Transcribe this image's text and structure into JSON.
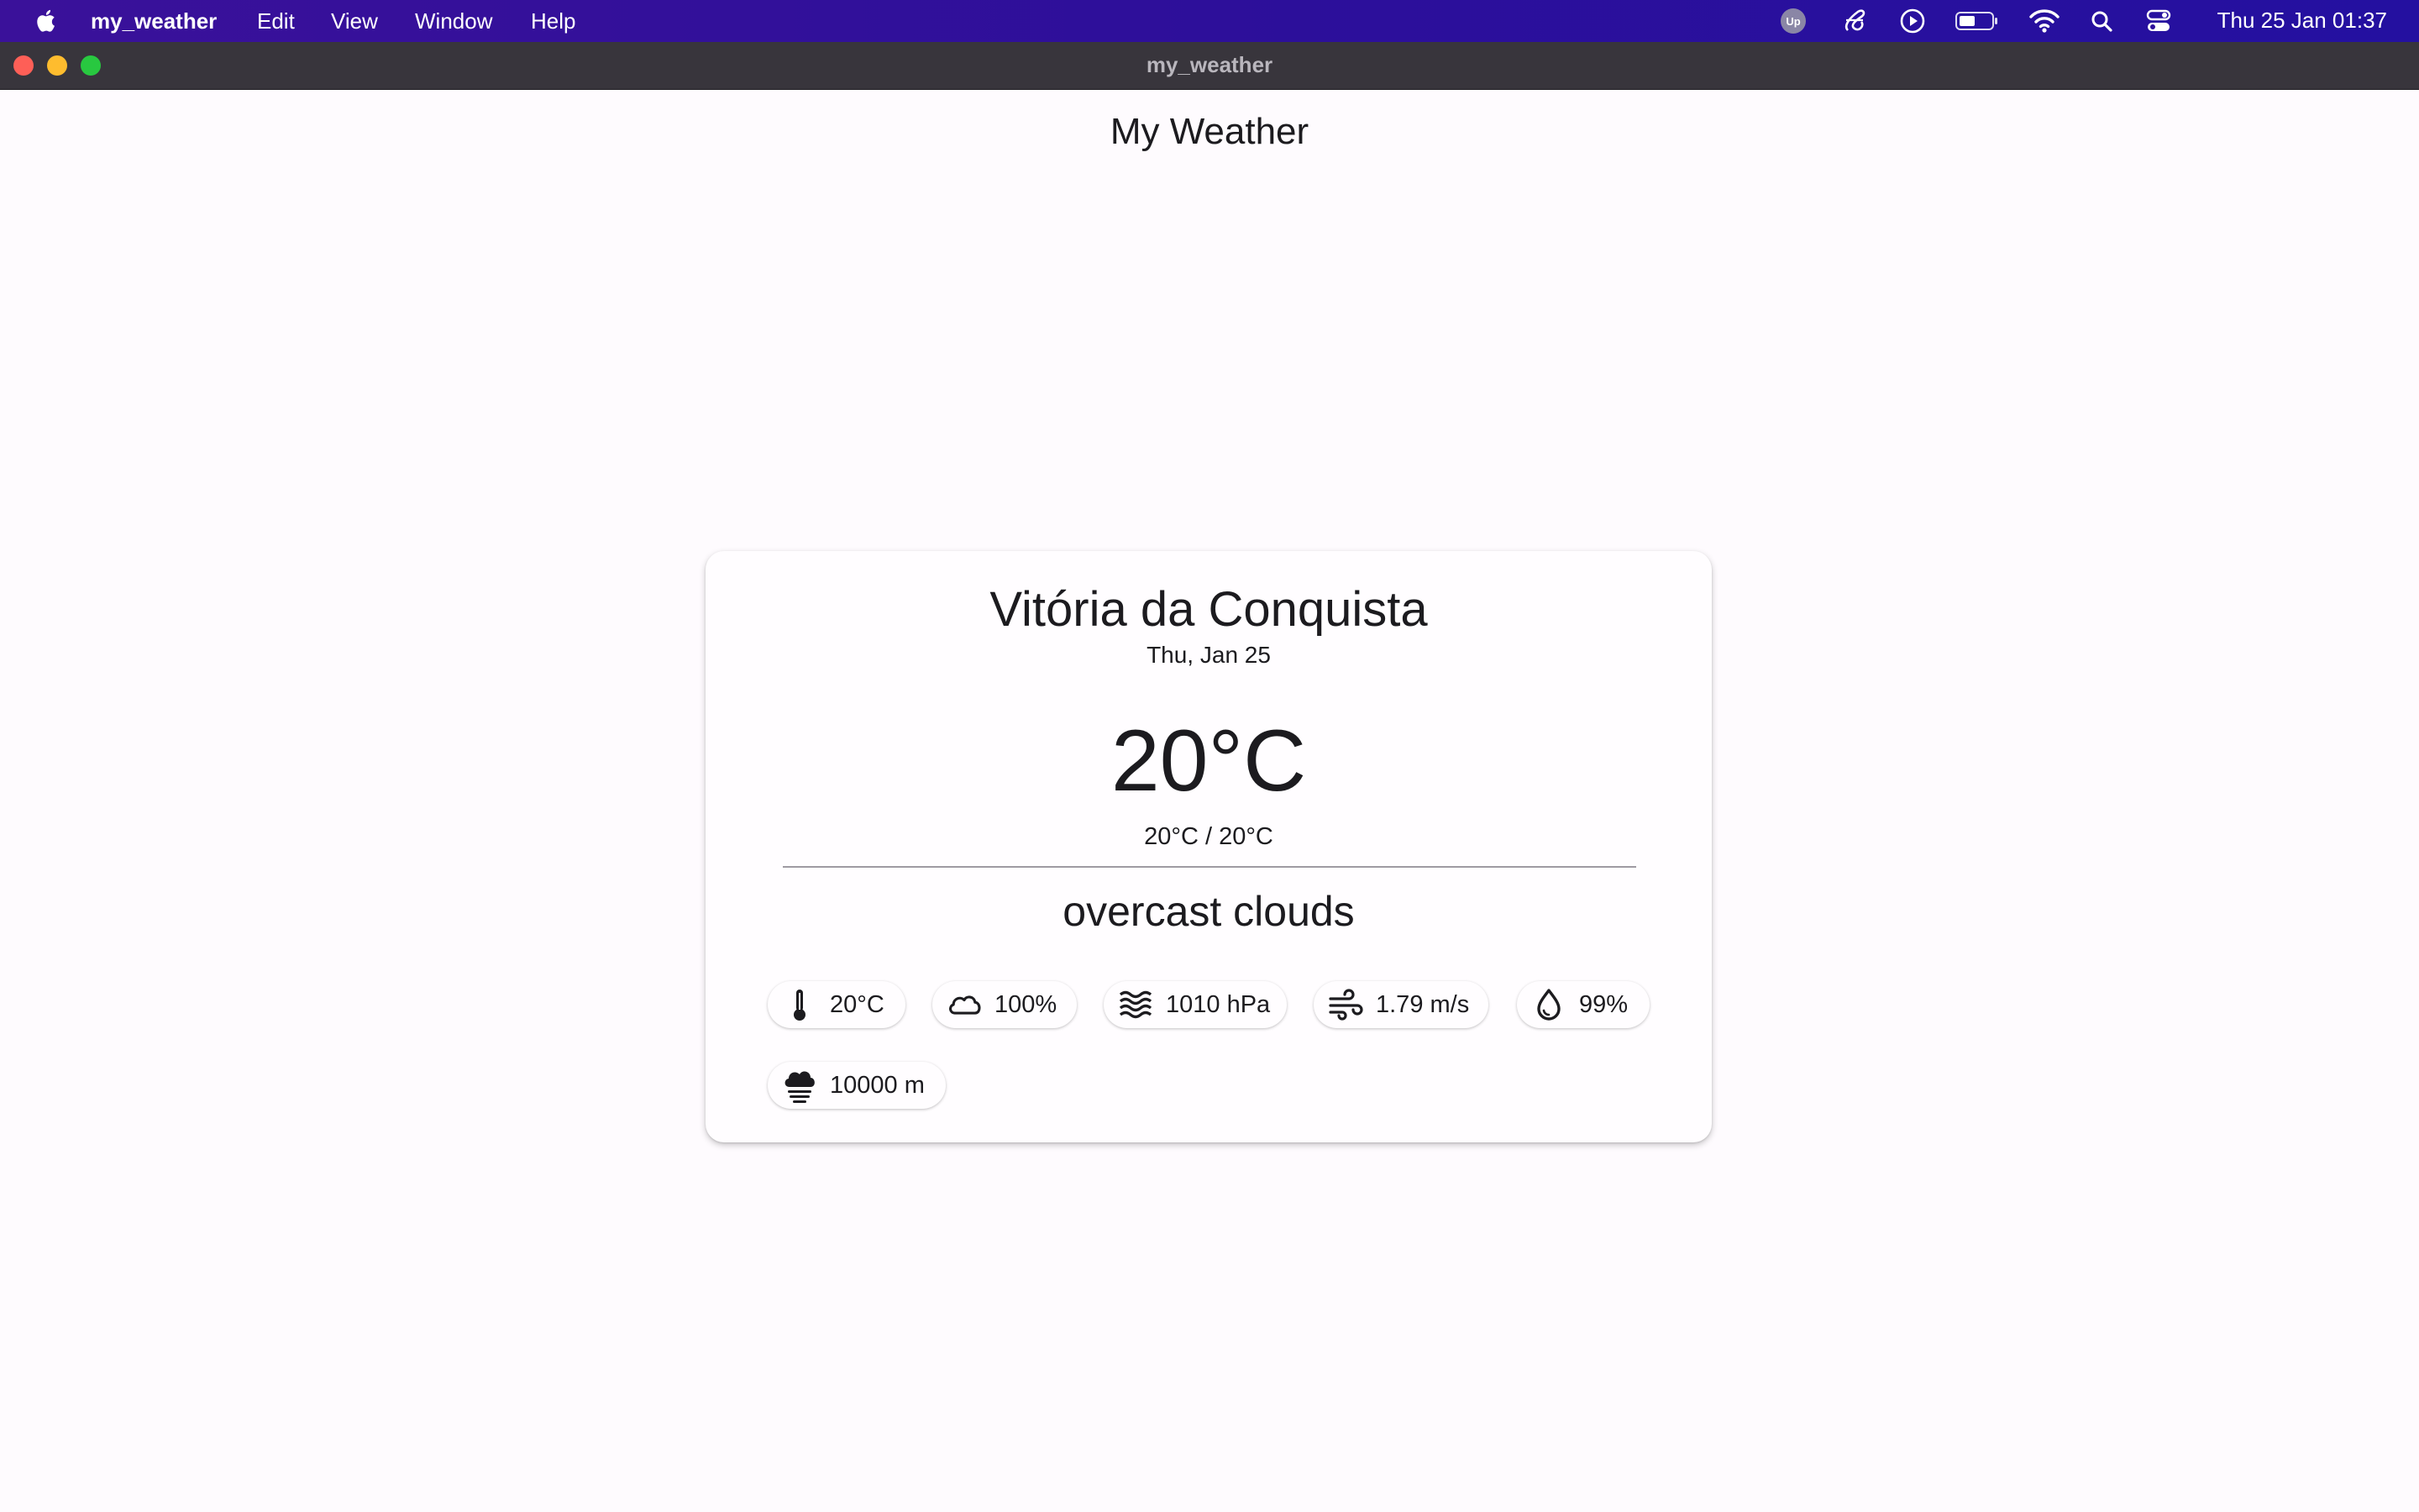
{
  "menubar": {
    "app_name": "my_weather",
    "menus": [
      "Edit",
      "View",
      "Window",
      "Help"
    ],
    "clock": "Thu 25 Jan  01:37",
    "status_icons": [
      "upwork-icon",
      "script-icon",
      "play-circle-icon",
      "battery-icon",
      "wifi-icon",
      "search-icon",
      "control-center-icon"
    ]
  },
  "window": {
    "title": "my_weather"
  },
  "app": {
    "title": "My Weather"
  },
  "weather": {
    "city": "Vitória da Conquista",
    "date": "Thu, Jan 25",
    "temperature": "20°C",
    "min_max": "20°C / 20°C",
    "condition": "overcast clouds",
    "details": [
      {
        "icon": "thermometer-icon",
        "value": "20°C"
      },
      {
        "icon": "cloud-icon",
        "value": "100%"
      },
      {
        "icon": "waves-icon",
        "value": "1010 hPa"
      },
      {
        "icon": "wind-icon",
        "value": "1.79 m/s"
      },
      {
        "icon": "water-drop-icon",
        "value": "99%"
      },
      {
        "icon": "foggy-icon",
        "value": "10000 m"
      }
    ]
  },
  "colors": {
    "menubar": "#3a119a",
    "background": "#fefbfe",
    "text": "#1c1b1f"
  }
}
